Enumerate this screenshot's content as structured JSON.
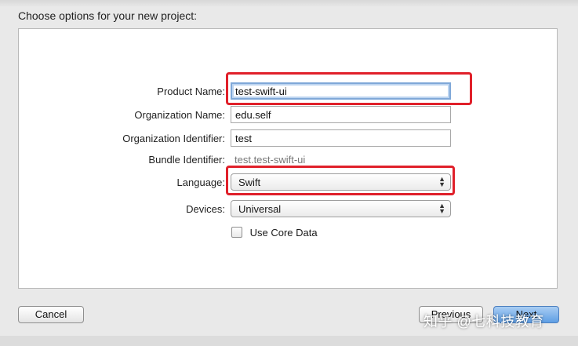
{
  "dialog": {
    "title": "Choose options for your new project:"
  },
  "form": {
    "product_name_label": "Product Name:",
    "product_name_value": "test-swift-ui",
    "organization_name_label": "Organization Name:",
    "organization_name_value": "edu.self",
    "organization_identifier_label": "Organization Identifier:",
    "organization_identifier_value": "test",
    "bundle_identifier_label": "Bundle Identifier:",
    "bundle_identifier_value": "test.test-swift-ui",
    "language_label": "Language:",
    "language_value": "Swift",
    "devices_label": "Devices:",
    "devices_value": "Universal",
    "core_data_label": "Use Core Data",
    "core_data_checked": false
  },
  "buttons": {
    "cancel": "Cancel",
    "previous": "Previous",
    "next": "Next"
  },
  "watermark": "知乎 @七科技教育",
  "colors": {
    "highlight_red": "#e0202a",
    "focus_blue": "#7fa8d8",
    "default_button_blue": "#5e9ee4"
  }
}
